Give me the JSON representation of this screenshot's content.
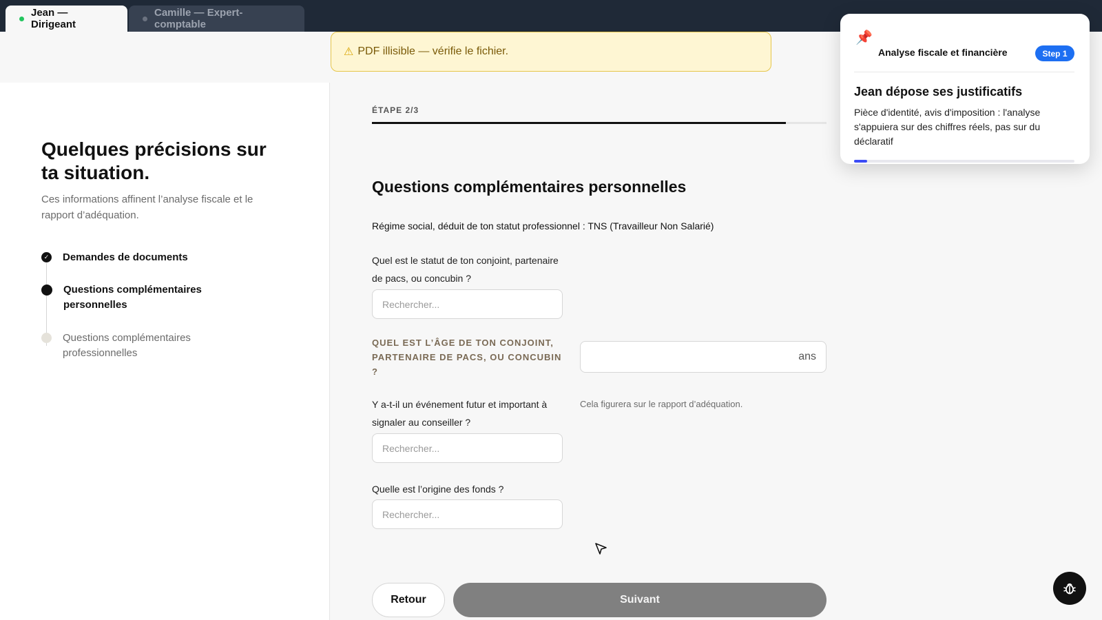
{
  "tabs": [
    {
      "label": "Jean — Dirigeant",
      "active": true,
      "status_color": "#22c55e"
    },
    {
      "label": "Camille — Expert-comptable",
      "active": false,
      "status_color": "#6b7280"
    }
  ],
  "warning": {
    "icon": "warning-icon",
    "text": "PDF illisible — vérifie le fichier."
  },
  "sidebar": {
    "title": "Quelques précisions sur ta situation.",
    "subtitle": "Ces informations affinent l’analyse fiscale et le rapport d’adéquation.",
    "steps": [
      {
        "label": "Demandes de documents",
        "state": "done"
      },
      {
        "label": "Questions complémentaires personnelles",
        "state": "current"
      },
      {
        "label": "Questions complémentaires professionnelles",
        "state": "todo"
      }
    ]
  },
  "form": {
    "step_counter": "ÉTAPE 2/3",
    "progress": 0.91,
    "title": "Questions complémentaires personnelles",
    "regime_text": "Régime social, déduit de ton statut professionnel : TNS (Travailleur Non Salarié)",
    "q_partner_status": "Quel est le statut de ton conjoint, partenaire de pacs, ou concubin ?",
    "q_partner_age": "QUEL EST L’ÂGE DE TON CONJOINT, PARTENAIRE DE PACS, OU CONCUBIN ?",
    "age_unit": "ans",
    "q_future_event": "Y a-t-il un événement futur et important à signaler au conseiller ?",
    "future_event_hint": "Cela figurera sur le rapport d’adéquation.",
    "q_funds_origin": "Quelle est l’origine des fonds ?",
    "search_placeholder": "Rechercher...",
    "back_label": "Retour",
    "next_label": "Suivant"
  },
  "tour": {
    "pin_icon": "pushpin-icon",
    "section": "Analyse fiscale et financière",
    "badge": "Step 1",
    "title": "Jean dépose ses justificatifs",
    "body": "Pièce d'identité, avis d'imposition : l'analyse s'appuiera sur des chiffres réels, pas sur du déclaratif",
    "progress": 0.06
  },
  "colors": {
    "accent": "#1d6ff2",
    "tour_progress": "#3b4cf6",
    "warning_bg": "#fef6d3",
    "next_button": "#808080"
  }
}
